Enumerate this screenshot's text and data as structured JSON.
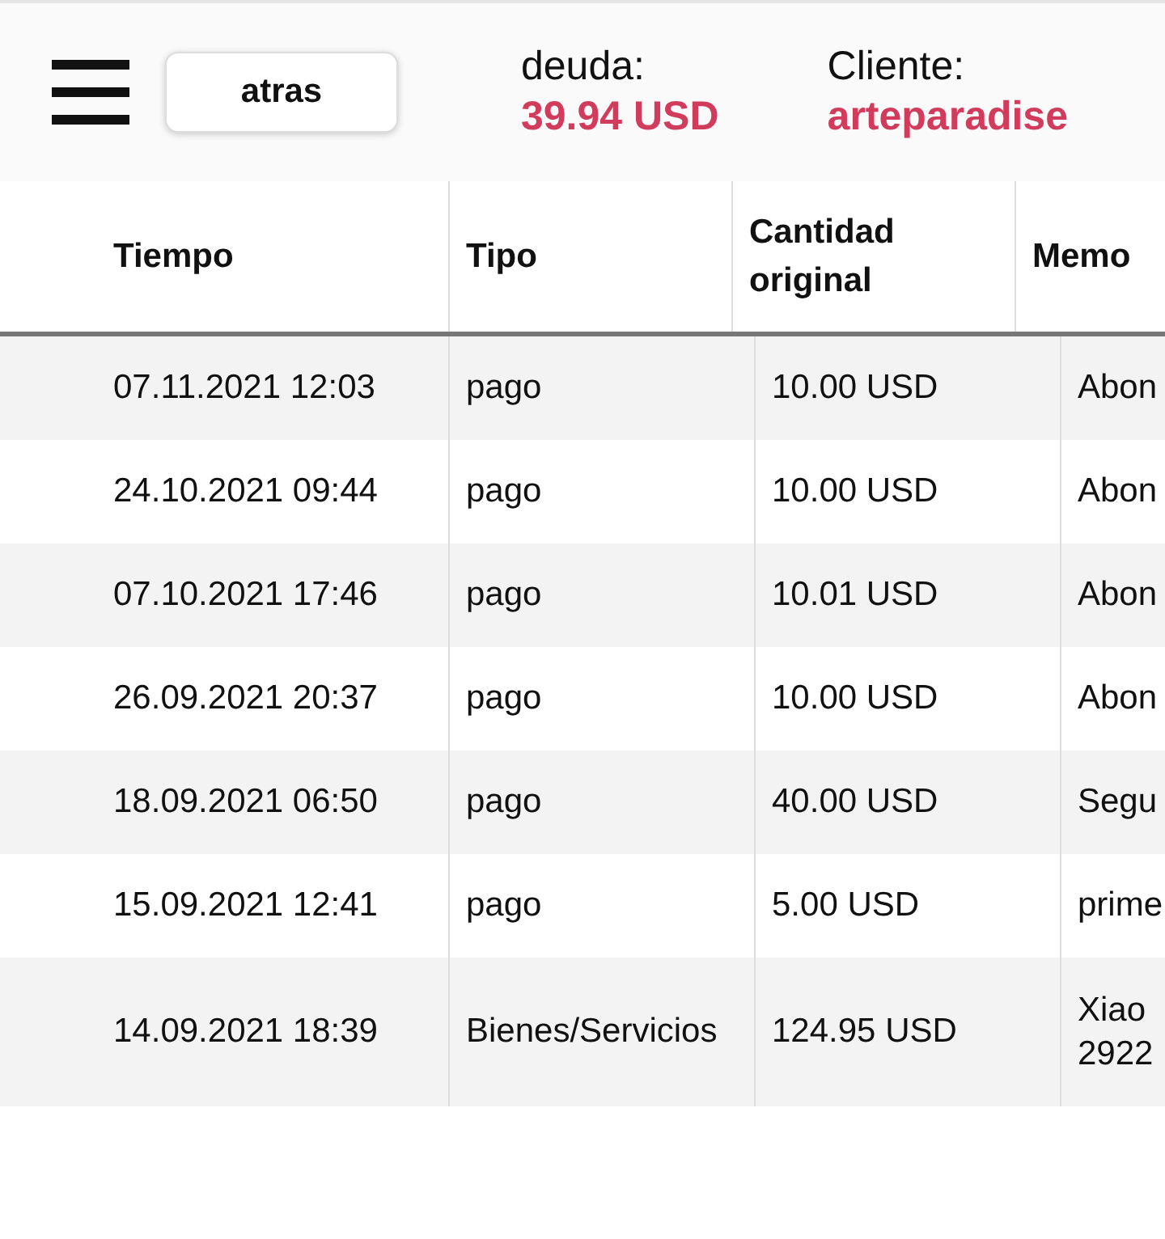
{
  "header": {
    "back_button": "atras",
    "debt": {
      "label": "deuda:",
      "value": "39.94 USD"
    },
    "client": {
      "label": "Cliente:",
      "value": "arteparadise"
    }
  },
  "table": {
    "columns": [
      "Tiempo",
      "Tipo",
      "Cantidad original",
      "Memo"
    ],
    "rows": [
      {
        "time": "07.11.2021 12:03",
        "type": "pago",
        "amount": "10.00 USD",
        "memo": [
          "Abon"
        ]
      },
      {
        "time": "24.10.2021 09:44",
        "type": "pago",
        "amount": "10.00 USD",
        "memo": [
          "Abon"
        ]
      },
      {
        "time": "07.10.2021 17:46",
        "type": "pago",
        "amount": "10.01 USD",
        "memo": [
          "Abon"
        ]
      },
      {
        "time": "26.09.2021 20:37",
        "type": "pago",
        "amount": "10.00 USD",
        "memo": [
          "Abon"
        ]
      },
      {
        "time": "18.09.2021 06:50",
        "type": "pago",
        "amount": "40.00 USD",
        "memo": [
          "Segu"
        ]
      },
      {
        "time": "15.09.2021 12:41",
        "type": "pago",
        "amount": "5.00 USD",
        "memo": [
          "prime"
        ]
      },
      {
        "time": "14.09.2021 18:39",
        "type": "Bienes/Servicios",
        "amount": "124.95 USD",
        "memo": [
          "Xiao",
          "2922"
        ]
      }
    ]
  }
}
